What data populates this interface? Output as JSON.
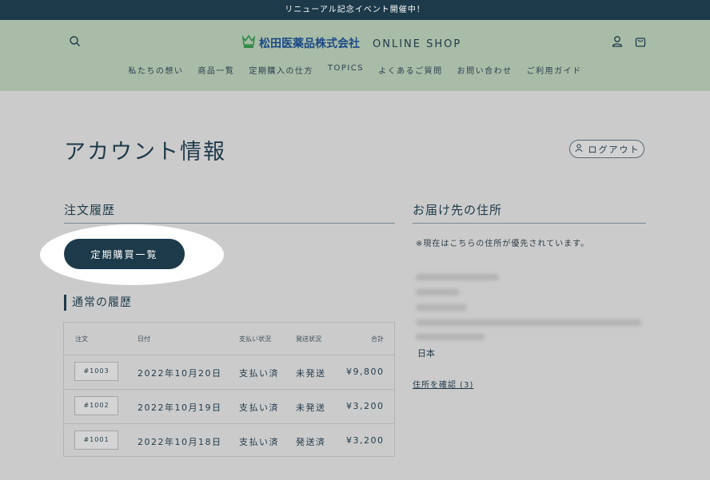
{
  "announcement": "リニューアル記念イベント開催中！",
  "header": {
    "logo_text": "松田医薬品株式会社",
    "shop_text": "ONLINE SHOP",
    "nav": [
      "私たちの想い",
      "商品一覧",
      "定期購入の仕方",
      "TOPICS",
      "よくあるご質問",
      "お問い合わせ",
      "ご利用ガイド"
    ]
  },
  "page": {
    "title": "アカウント情報",
    "logout_label": "ログアウト"
  },
  "orders": {
    "section_title": "注文履歴",
    "subscription_button": "定期購買一覧",
    "history_title": "通常の履歴",
    "columns": [
      "注文",
      "日付",
      "支払い状況",
      "発送状況",
      "合計"
    ],
    "rows": [
      {
        "id": "#1003",
        "date": "2022年10月20日",
        "payment": "支払い済",
        "shipping": "未発送",
        "total": "¥9,800"
      },
      {
        "id": "#1002",
        "date": "2022年10月19日",
        "payment": "支払い済",
        "shipping": "未発送",
        "total": "¥3,200"
      },
      {
        "id": "#1001",
        "date": "2022年10月18日",
        "payment": "支払い済",
        "shipping": "発送済",
        "total": "¥3,200"
      }
    ]
  },
  "address": {
    "section_title": "お届け先の住所",
    "note": "※現在はこちらの住所が優先されています。",
    "country": "日本",
    "view_link": "住所を確認 (3)"
  },
  "colors": {
    "header_bg": "#a9bca7",
    "dark_navy": "#1c3a4a",
    "page_bg": "#cbcbcb",
    "logo_blue": "#1a4a86",
    "logo_green": "#2f8a45"
  },
  "icons": {
    "search": "search-icon",
    "account": "person-icon",
    "cart": "bag-icon",
    "logo": "crown-icon"
  }
}
